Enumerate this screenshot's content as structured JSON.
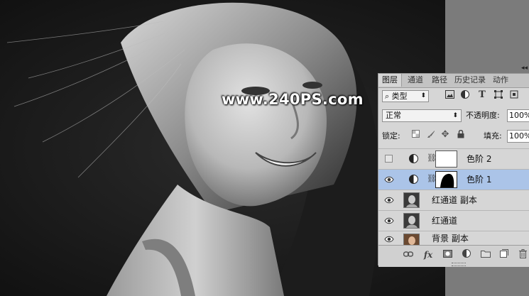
{
  "watermark": "www.240PS.com",
  "panel": {
    "collapse": "◂◂",
    "tabs": [
      "图层",
      "通道",
      "路径",
      "历史记录",
      "动作"
    ],
    "filter": {
      "label": "类型",
      "search_glyph": "⌕",
      "arrow": "⬍"
    },
    "filter_icons": [
      "image-filter-icon",
      "adjustment-filter-icon",
      "text-filter-icon",
      "shape-filter-icon",
      "smart-object-filter-icon"
    ],
    "blend_mode": {
      "value": "正常",
      "arrow": "⬍"
    },
    "opacity": {
      "label": "不透明度:",
      "value": "100%"
    },
    "lock": {
      "label": "锁定:"
    },
    "fill": {
      "label": "填充:",
      "value": "100%"
    },
    "layers": [
      {
        "name": "色阶 2",
        "visible": false,
        "selected": false,
        "type": "adjustment"
      },
      {
        "name": "色阶 1",
        "visible": true,
        "selected": true,
        "type": "adjustment"
      },
      {
        "name": "红通道 副本",
        "visible": true,
        "selected": false,
        "type": "image"
      },
      {
        "name": "红通道",
        "visible": true,
        "selected": false,
        "type": "image"
      },
      {
        "name": "背景 副本",
        "visible": true,
        "selected": false,
        "type": "image"
      }
    ]
  }
}
